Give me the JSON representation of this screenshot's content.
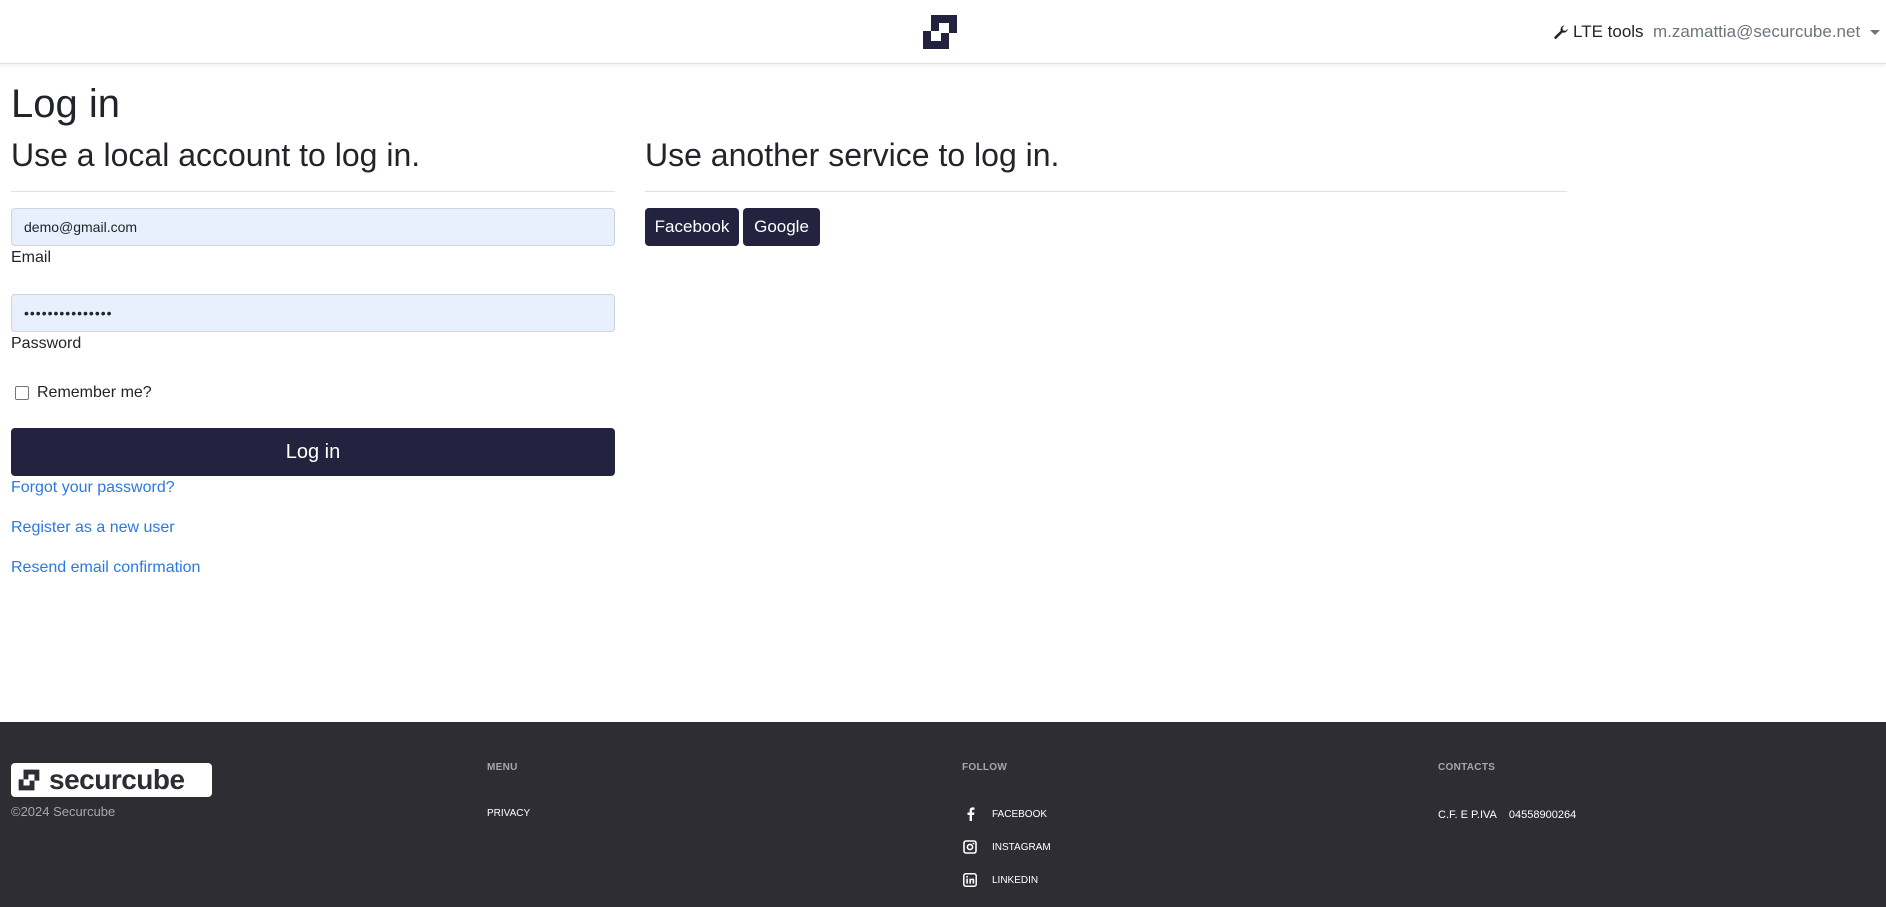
{
  "header": {
    "tools_label": "LTE tools",
    "user_email": "m.zamattia@securcube.net"
  },
  "main": {
    "title": "Log in",
    "local_heading": "Use a local account to log in.",
    "service_heading": "Use another service to log in.",
    "email": {
      "value": "demo@gmail.com",
      "label": "Email"
    },
    "password": {
      "value": "•••••••••••••••",
      "label": "Password"
    },
    "remember_label": "Remember me?",
    "login_label": "Log in",
    "links": {
      "forgot": "Forgot your password?",
      "register": "Register as a new user",
      "resend": "Resend email confirmation"
    },
    "providers": [
      "Facebook",
      "Google"
    ]
  },
  "footer": {
    "logo_text": "securcube",
    "copyright": "©2024 Securcube",
    "menu_title": "MENU",
    "menu_items": [
      "PRIVACY"
    ],
    "follow_title": "FOLLOW",
    "social": [
      "FACEBOOK",
      "INSTAGRAM",
      "LINKEDIN"
    ],
    "contacts_title": "CONTACTS",
    "vat_label": "C.F. E P.IVA",
    "vat_number": "04558900264"
  },
  "colors": {
    "brand_dark": "#23233f",
    "link": "#2a7ae2",
    "footer_bg": "#2e2d33",
    "autofill_bg": "#e8f0fe"
  }
}
